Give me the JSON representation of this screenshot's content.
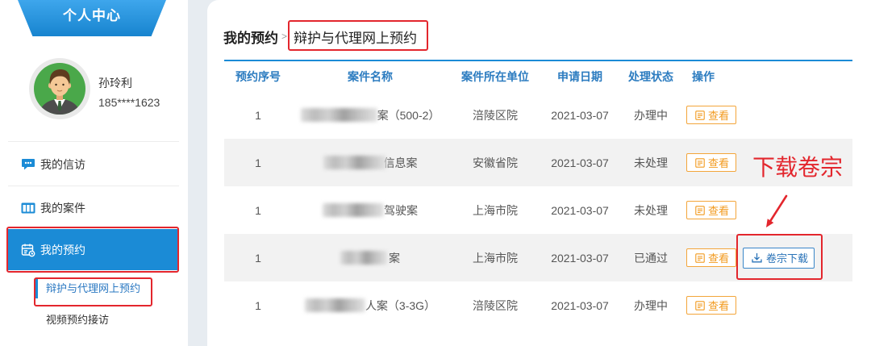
{
  "sidebar": {
    "header_title": "个人中心",
    "user": {
      "name": "孙玲利",
      "phone": "185****1623",
      "avatar_icon": "user-avatar-icon"
    },
    "menu": [
      {
        "label": "我的信访",
        "icon": "message-icon",
        "active": false
      },
      {
        "label": "我的案件",
        "icon": "case-grid-icon",
        "active": false
      },
      {
        "label": "我的预约",
        "icon": "calendar-icon",
        "active": true
      }
    ],
    "submenu": [
      {
        "label": "辩护与代理网上预约",
        "active": true
      },
      {
        "label": "视频预约接访",
        "active": false
      }
    ]
  },
  "breadcrumb": {
    "parent": "我的预约",
    "separator": ">",
    "current": "辩护与代理网上预约"
  },
  "table": {
    "headers": [
      "预约序号",
      "案件名称",
      "案件所在单位",
      "申请日期",
      "处理状态",
      "操作"
    ],
    "rows": [
      {
        "seq": "1",
        "case_name": "案（500-2）",
        "unit": "涪陵区院",
        "date": "2021-03-07",
        "status": "办理中",
        "actions": [
          "查看"
        ]
      },
      {
        "seq": "1",
        "case_name": "信息案",
        "unit": "安徽省院",
        "date": "2021-03-07",
        "status": "未处理",
        "actions": [
          "查看"
        ]
      },
      {
        "seq": "1",
        "case_name": "驾驶案",
        "unit": "上海市院",
        "date": "2021-03-07",
        "status": "未处理",
        "actions": [
          "查看"
        ]
      },
      {
        "seq": "1",
        "case_name": "案",
        "unit": "上海市院",
        "date": "2021-03-07",
        "status": "已通过",
        "actions": [
          "查看",
          "卷宗下载"
        ]
      },
      {
        "seq": "1",
        "case_name": "人案（3-3G）",
        "unit": "涪陵区院",
        "date": "2021-03-07",
        "status": "办理中",
        "actions": [
          "查看"
        ]
      }
    ],
    "view_icon": "view-doc-icon",
    "download_icon": "download-icon"
  },
  "annotation": {
    "callout": "下载卷宗",
    "arrow_icon": "arrow-down-left-icon"
  },
  "colors": {
    "primary_blue": "#1b8bd6",
    "header_text_blue": "#2c7cc0",
    "view_button_orange": "#f29a1f",
    "download_button_blue": "#2a73b8",
    "annotation_red": "#e3262d",
    "alt_row_gray": "#f2f2f2"
  }
}
